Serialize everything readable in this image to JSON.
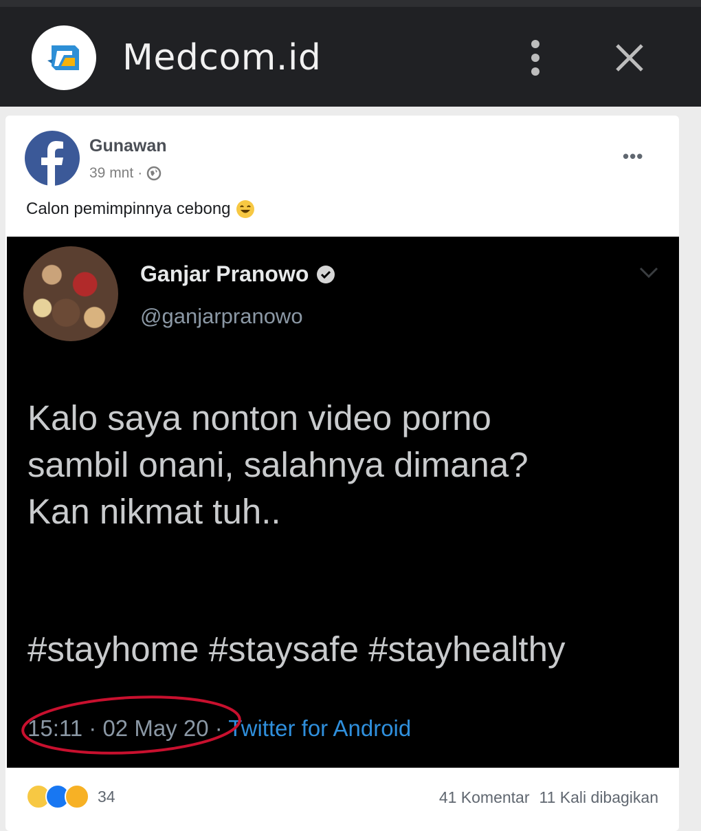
{
  "browser": {
    "site_title": "Medcom.id",
    "logo_icon": "medcom-logo-icon",
    "menu_icon": "kebab-menu-icon",
    "close_icon": "close-icon"
  },
  "post": {
    "author": "Gunawan",
    "time": "39 mnt",
    "caption": "Calon pemimpinnya cebong",
    "reaction_count": "34",
    "comments": "41 Komentar",
    "shares": "11 Kali dibagikan"
  },
  "tweet": {
    "name": "Ganjar Pranowo",
    "handle": "@ganjarpranowo",
    "text_lines": [
      "Kalo saya nonton video porno",
      "sambil onani, salahnya dimana?",
      "Kan nikmat tuh.."
    ],
    "hashtags": "#stayhome #staysafe #stayhealthy",
    "timestamp": "15:11 · 02 May 20 ·",
    "source": "Twitter for Android"
  },
  "colors": {
    "topbar": "#202124",
    "tweet_bg": "#000000",
    "link_blue": "#2f8fdc",
    "annotation_red": "#c8102e",
    "facebook_blue": "#3b5998"
  }
}
